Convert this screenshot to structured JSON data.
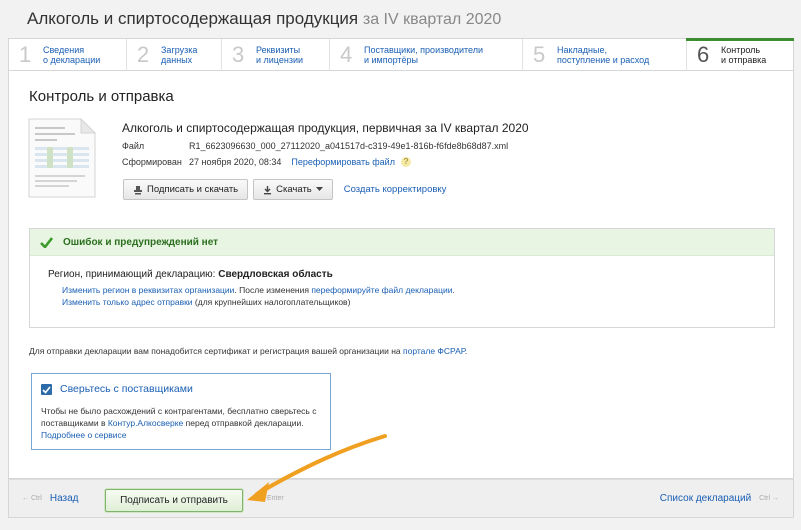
{
  "header": {
    "title": "Алкоголь и спиртосодержащая продукция",
    "subtitle": "за IV квартал 2020"
  },
  "steps": [
    {
      "num": "1",
      "label": "Сведения\nо декларации"
    },
    {
      "num": "2",
      "label": "Загрузка\nданных"
    },
    {
      "num": "3",
      "label": "Реквизиты\nи лицензии"
    },
    {
      "num": "4",
      "label": "Поставщики, производители\nи импортёры"
    },
    {
      "num": "5",
      "label": "Накладные,\nпоступление и расход"
    },
    {
      "num": "6",
      "label": "Контроль\nи отправка"
    }
  ],
  "panel": {
    "title": "Контроль и отправка"
  },
  "doc": {
    "title": "Алкоголь и спиртосодержащая продукция, первичная за IV квартал 2020",
    "file_label": "Файл",
    "file_value": "R1_6623096630_000_27112020_a041517d-c319-49e1-816b-f6fde8b68d87.xml",
    "formed_label": "Сформирован",
    "formed_value": "27 ноября 2020, 08:34",
    "reform_link": "Переформировать файл",
    "help": "?"
  },
  "buttons": {
    "sign_download": "Подписать и скачать",
    "download": "Скачать",
    "create_correction": "Создать корректировку"
  },
  "check": {
    "ok_text": "Ошибок и предупреждений нет",
    "region_label": "Регион, принимающий декларацию:",
    "region_value": "Свердловская область",
    "hint1_link": "Изменить регион в реквизитах организации",
    "hint1_mid": ". После изменения ",
    "hint1_link2": "переформируйте файл декларации",
    "hint1_end": ".",
    "hint2_link": "Изменить только адрес отправки",
    "hint2_text": " (для крупнейших налогоплательщиков)"
  },
  "fsrar": {
    "text": "Для отправки декларации вам понадобится сертификат и регистрация вашей организации на ",
    "link": "портале ФСРАР",
    "end": "."
  },
  "promo": {
    "title": "Сверьтесь с поставщиками",
    "text1": "Чтобы не было расхождений с контрагентами, бесплатно сверьтесь с поставщиками в ",
    "link": "Контур.Алкосверке",
    "text2": " перед отправкой декларации.",
    "more": "Подробнее о сервисе"
  },
  "footer": {
    "back_key": "← Ctrl",
    "back": "Назад",
    "sign_send": "Подписать и отправить",
    "ctrl_enter": "Ctrl+Enter",
    "list": "Список деклараций",
    "list_key": "Ctrl →"
  },
  "colors": {
    "accent_green": "#3c8d2f",
    "link_blue": "#1a5fb4",
    "arrow_orange": "#f0a020"
  }
}
